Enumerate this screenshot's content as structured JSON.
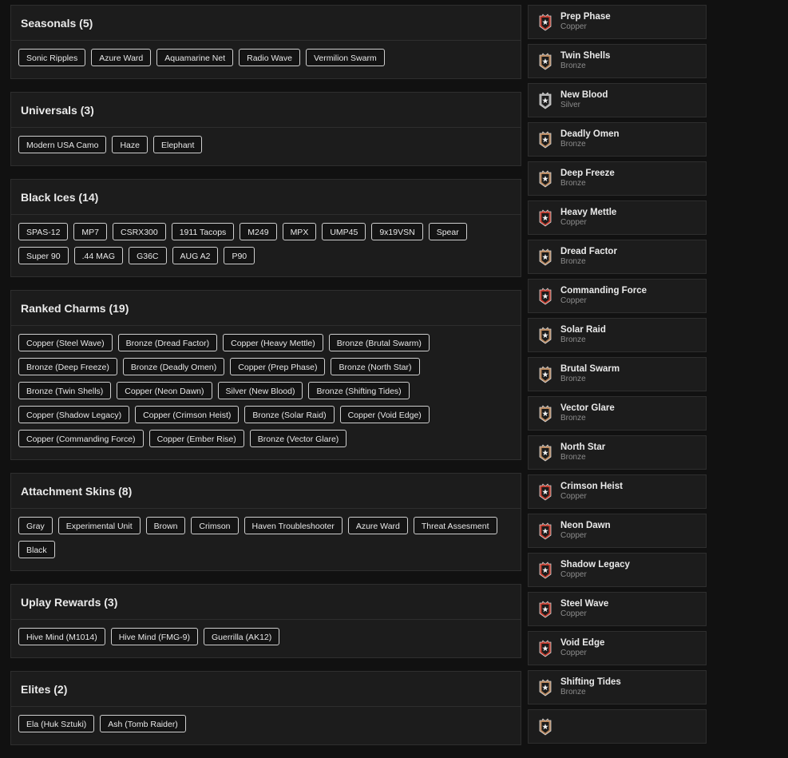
{
  "colors": {
    "background": "#111111",
    "panel": "#1c1c1c",
    "border": "#2e2e2e",
    "copper": "#c0392b",
    "bronze": "#b8865b",
    "silver": "#b0b0b0"
  },
  "sections": [
    {
      "title": "Seasonals (5)",
      "items": [
        "Sonic Ripples",
        "Azure Ward",
        "Aquamarine Net",
        "Radio Wave",
        "Vermilion Swarm"
      ]
    },
    {
      "title": "Universals (3)",
      "items": [
        "Modern USA Camo",
        "Haze",
        "Elephant"
      ]
    },
    {
      "title": "Black Ices (14)",
      "items": [
        "SPAS-12",
        "MP7",
        "CSRX300",
        "1911 Tacops",
        "M249",
        "MPX",
        "UMP45",
        "9x19VSN",
        "Spear",
        "Super 90",
        ".44 MAG",
        "G36C",
        "AUG A2",
        "P90"
      ]
    },
    {
      "title": "Ranked Charms (19)",
      "items": [
        "Copper (Steel Wave)",
        "Bronze (Dread Factor)",
        "Copper (Heavy Mettle)",
        "Bronze (Brutal Swarm)",
        "Bronze (Deep Freeze)",
        "Bronze (Deadly Omen)",
        "Copper (Prep Phase)",
        "Bronze (North Star)",
        "Bronze (Twin Shells)",
        "Copper (Neon Dawn)",
        "Silver (New Blood)",
        "Bronze (Shifting Tides)",
        "Copper (Shadow Legacy)",
        "Copper (Crimson Heist)",
        "Bronze (Solar Raid)",
        "Copper (Void Edge)",
        "Copper (Commanding Force)",
        "Copper (Ember Rise)",
        "Bronze (Vector Glare)"
      ]
    },
    {
      "title": "Attachment Skins (8)",
      "items": [
        "Gray",
        "Experimental Unit",
        "Brown",
        "Crimson",
        "Haven Troubleshooter",
        "Azure Ward",
        "Threat Assesment",
        "Black"
      ]
    },
    {
      "title": "Uplay Rewards (3)",
      "items": [
        "Hive Mind (M1014)",
        "Hive Mind (FMG-9)",
        "Guerrilla (AK12)"
      ]
    },
    {
      "title": "Elites (2)",
      "items": [
        "Ela (Huk Sztuki)",
        "Ash (Tomb Raider)"
      ]
    }
  ],
  "charms": [
    {
      "name": "Prep Phase",
      "tier": "Copper",
      "icon": "copper-rank-icon"
    },
    {
      "name": "Twin Shells",
      "tier": "Bronze",
      "icon": "bronze-rank-icon"
    },
    {
      "name": "New Blood",
      "tier": "Silver",
      "icon": "silver-rank-icon"
    },
    {
      "name": "Deadly Omen",
      "tier": "Bronze",
      "icon": "bronze-rank-icon"
    },
    {
      "name": "Deep Freeze",
      "tier": "Bronze",
      "icon": "bronze-rank-icon"
    },
    {
      "name": "Heavy Mettle",
      "tier": "Copper",
      "icon": "copper-rank-icon"
    },
    {
      "name": "Dread Factor",
      "tier": "Bronze",
      "icon": "bronze-rank-icon"
    },
    {
      "name": "Commanding Force",
      "tier": "Copper",
      "icon": "copper-rank-icon"
    },
    {
      "name": "Solar Raid",
      "tier": "Bronze",
      "icon": "bronze-rank-icon"
    },
    {
      "name": "Brutal Swarm",
      "tier": "Bronze",
      "icon": "bronze-rank-icon"
    },
    {
      "name": "Vector Glare",
      "tier": "Bronze",
      "icon": "bronze-rank-icon"
    },
    {
      "name": "North Star",
      "tier": "Bronze",
      "icon": "bronze-rank-icon"
    },
    {
      "name": "Crimson Heist",
      "tier": "Copper",
      "icon": "copper-rank-icon"
    },
    {
      "name": "Neon Dawn",
      "tier": "Copper",
      "icon": "copper-rank-icon"
    },
    {
      "name": "Shadow Legacy",
      "tier": "Copper",
      "icon": "copper-rank-icon"
    },
    {
      "name": "Steel Wave",
      "tier": "Copper",
      "icon": "copper-rank-icon"
    },
    {
      "name": "Void Edge",
      "tier": "Copper",
      "icon": "copper-rank-icon"
    },
    {
      "name": "Shifting Tides",
      "tier": "Bronze",
      "icon": "bronze-rank-icon"
    },
    {
      "name": "",
      "tier": "",
      "icon": "bronze-rank-icon"
    }
  ]
}
